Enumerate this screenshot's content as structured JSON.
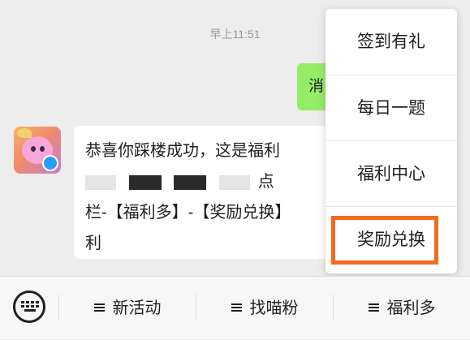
{
  "chat": {
    "timestamp": "早上11:51",
    "sent_message": "消",
    "received_lines": [
      "恭喜你踩楼成功，这是福利",
      "点",
      "栏-【福利多】-【奖励兑换】",
      "利"
    ]
  },
  "popup_menu": {
    "items": [
      {
        "label": "签到有礼"
      },
      {
        "label": "每日一题"
      },
      {
        "label": "福利中心"
      },
      {
        "label": "奖励兑换",
        "highlighted": true
      }
    ],
    "highlight_color": "#f26b21"
  },
  "bottom_menu": {
    "keyboard_icon": "keyboard-icon",
    "items": [
      {
        "label": "新活动",
        "icon": "menu-lines-icon"
      },
      {
        "label": "找喵粉",
        "icon": "menu-lines-icon"
      },
      {
        "label": "福利多",
        "icon": "menu-lines-icon"
      }
    ]
  },
  "colors": {
    "chat_background": "#ededed",
    "sent_bubble": "#95ec69",
    "received_bubble": "#ffffff"
  }
}
